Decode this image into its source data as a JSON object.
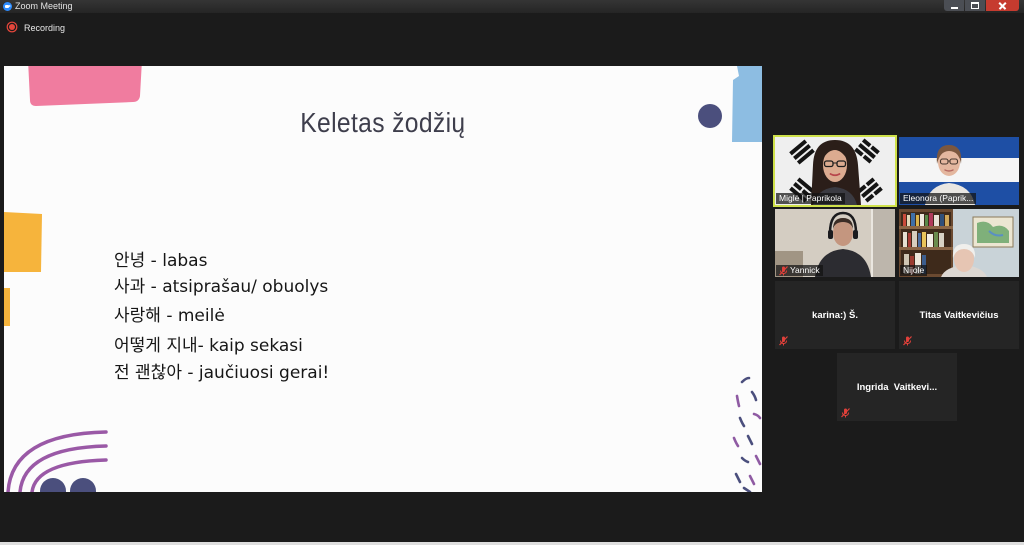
{
  "window": {
    "title": "Zoom Meeting",
    "app_icon": "zoom-app-icon",
    "minimize_icon": "minimize-icon",
    "maximize_icon": "maximize-icon",
    "close_icon": "close-icon",
    "background_color": "#1b1b1b",
    "close_button_color": "#c63b2f"
  },
  "recording": {
    "label": "Recording",
    "icon": "recording-icon",
    "color": "#e5463b"
  },
  "shared_screen": {
    "title": "Keletas žodžių",
    "lines": [
      "안녕 - labas",
      "사과 - atsiprašau/ obuolys",
      "사랑해 - meilė",
      "어떻게 지내- kaip sekasi",
      "전 괜찮아 - jaučiuosi gerai!"
    ],
    "background_color": "#fcfcfc",
    "decoration_colors": {
      "pink": "#f07c9f",
      "navy": "#4b4f7d",
      "light_blue": "#8dbde2",
      "yellow": "#f6b43c",
      "purple": "#9a59a6"
    }
  },
  "gallery": {
    "active_speaker_border_color": "#cfe14a",
    "muted_icon": "microphone-muted-icon",
    "muted_icon_color": "#e0403a",
    "participants": [
      {
        "name": "Miglė | Paprikola",
        "video_on": true,
        "active_speaker": true,
        "muted": false
      },
      {
        "name": "Eleonora (Paprik...",
        "video_on": true,
        "active_speaker": false,
        "muted": false
      },
      {
        "name": "Yannick",
        "video_on": true,
        "active_speaker": false,
        "muted": true
      },
      {
        "name": "Nijole",
        "video_on": true,
        "active_speaker": false,
        "muted": false
      },
      {
        "name": "karina:) Š.",
        "video_on": false,
        "active_speaker": false,
        "muted": true
      },
      {
        "name": "Titas Vaitkevičius",
        "video_on": false,
        "active_speaker": false,
        "muted": true
      },
      {
        "name": "Ingrida  Vaitkevi...",
        "video_on": false,
        "active_speaker": false,
        "muted": true
      }
    ]
  }
}
